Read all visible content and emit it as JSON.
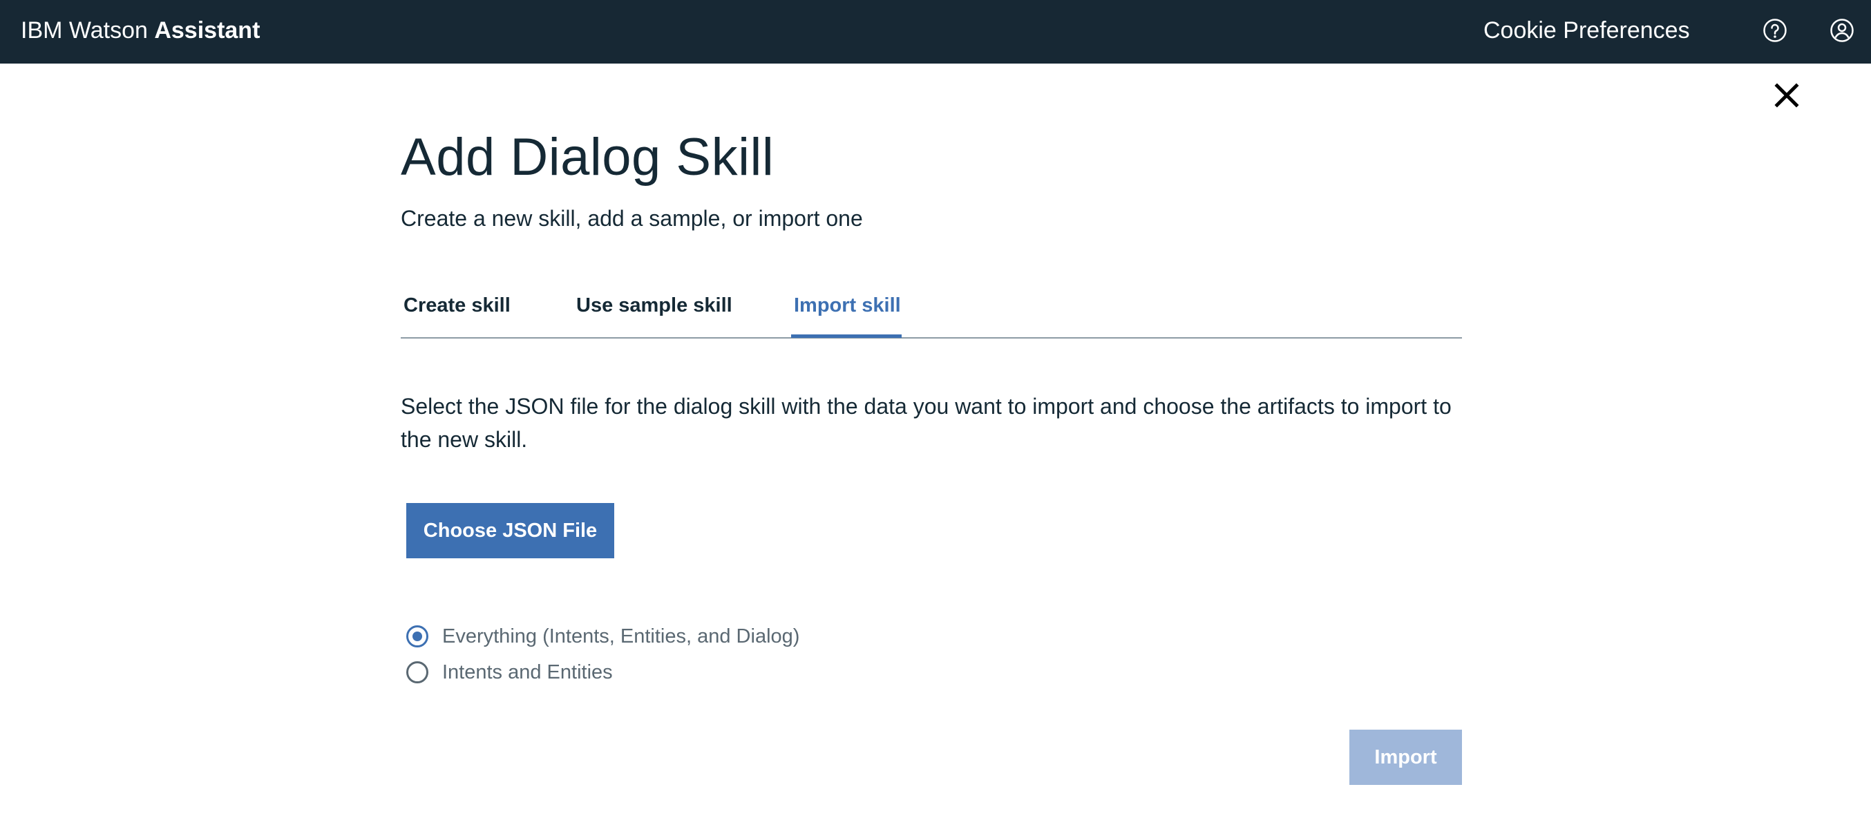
{
  "header": {
    "brand_regular": "IBM Watson ",
    "brand_bold": "Assistant",
    "cookie_preferences": "Cookie Preferences",
    "help_icon": "question-circle",
    "user_icon": "user-circle"
  },
  "dialog": {
    "close_icon": "close-x",
    "title": "Add Dialog Skill",
    "subtitle": "Create a new skill, add a sample, or import one",
    "tabs": [
      {
        "label": "Create skill",
        "active": false
      },
      {
        "label": "Use sample skill",
        "active": false
      },
      {
        "label": "Import skill",
        "active": true
      }
    ],
    "description": "Select the JSON file for the dialog skill with the data you want to import and choose the artifacts to import to the new skill.",
    "choose_button": "Choose JSON File",
    "options": [
      {
        "label": "Everything (Intents, Entities, and Dialog)",
        "selected": true
      },
      {
        "label": "Intents and Entities",
        "selected": false
      }
    ],
    "import_button": "Import",
    "import_enabled": false
  },
  "colors": {
    "header_bg": "#172834",
    "accent": "#3d70b2",
    "text": "#152935",
    "muted_text": "#5a6872",
    "disabled_button": "#9fb7da"
  }
}
